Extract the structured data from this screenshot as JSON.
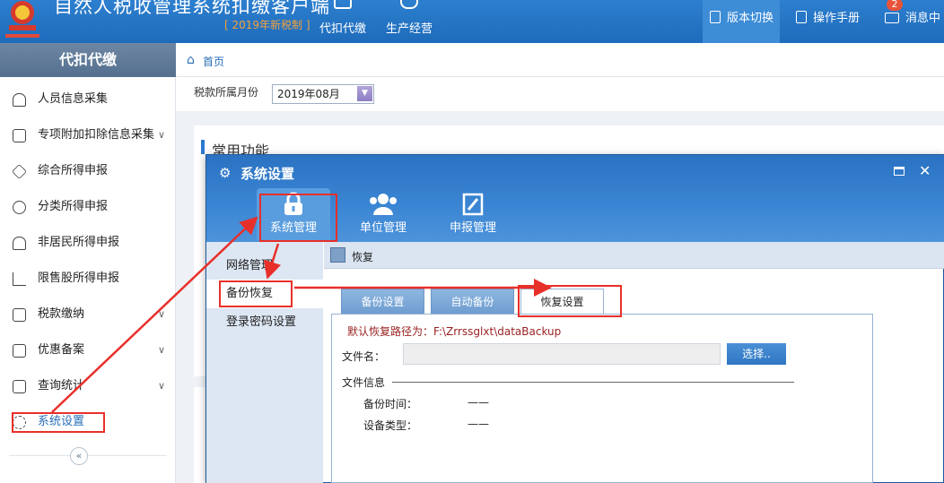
{
  "topbar": {
    "title": "自然人税收管理系统扣缴客户端",
    "subtitle": "[ 2019年新税制 ]",
    "nav": [
      {
        "label": "代扣代缴"
      },
      {
        "label": "生产经营"
      }
    ],
    "buttons": {
      "version": "版本切换",
      "manual": "操作手册",
      "messages": "消息中"
    },
    "message_count": "2"
  },
  "sidebar": {
    "header": "代扣代缴",
    "items": [
      {
        "label": "人员信息采集",
        "icon": "person-icon"
      },
      {
        "label": "专项附加扣除信息采集",
        "icon": "list-icon",
        "expandable": true
      },
      {
        "label": "综合所得申报",
        "icon": "layers-icon"
      },
      {
        "label": "分类所得申报",
        "icon": "pie-icon"
      },
      {
        "label": "非居民所得申报",
        "icon": "person-outline-icon"
      },
      {
        "label": "限售股所得申报",
        "icon": "bar-chart-icon"
      },
      {
        "label": "税款缴纳",
        "icon": "wallet-icon",
        "expandable": true
      },
      {
        "label": "优惠备案",
        "icon": "document-icon",
        "expandable": true
      },
      {
        "label": "查询统计",
        "icon": "search-list-icon",
        "expandable": true
      },
      {
        "label": "系统设置",
        "icon": "gear-icon",
        "active": true
      }
    ],
    "collapse_glyph": "«"
  },
  "breadcrumb": {
    "home": "首页"
  },
  "period": {
    "label": "税款所属月份",
    "value": "2019年08月"
  },
  "common": {
    "title": "常用功能"
  },
  "dialog": {
    "title": "系统设置",
    "tabs": [
      {
        "label": "系统管理",
        "active": true
      },
      {
        "label": "单位管理"
      },
      {
        "label": "申报管理"
      }
    ],
    "nav": [
      {
        "label": "网络管理"
      },
      {
        "label": "备份恢复",
        "active": true
      },
      {
        "label": "登录密码设置"
      }
    ],
    "toolbar": {
      "restore": "恢复"
    },
    "subtabs": [
      {
        "label": "备份设置"
      },
      {
        "label": "自动备份"
      },
      {
        "label": "恢复设置",
        "active": true
      }
    ],
    "restore": {
      "default_path": "默认恢复路径为：F:\\Zrrssglxt\\dataBackup",
      "filename_label": "文件名：",
      "filename_value": "",
      "choose_button": "选择..",
      "file_info_label": "文件信息",
      "backup_time_label": "备份时间：",
      "backup_time_value": "——",
      "device_type_label": "设备类型：",
      "device_type_value": "——"
    }
  },
  "colors": {
    "topbar": "#1e6bbb",
    "accent": "#2a7ad0",
    "annotation": "#e8302a",
    "path_text": "#9a1f1f"
  }
}
